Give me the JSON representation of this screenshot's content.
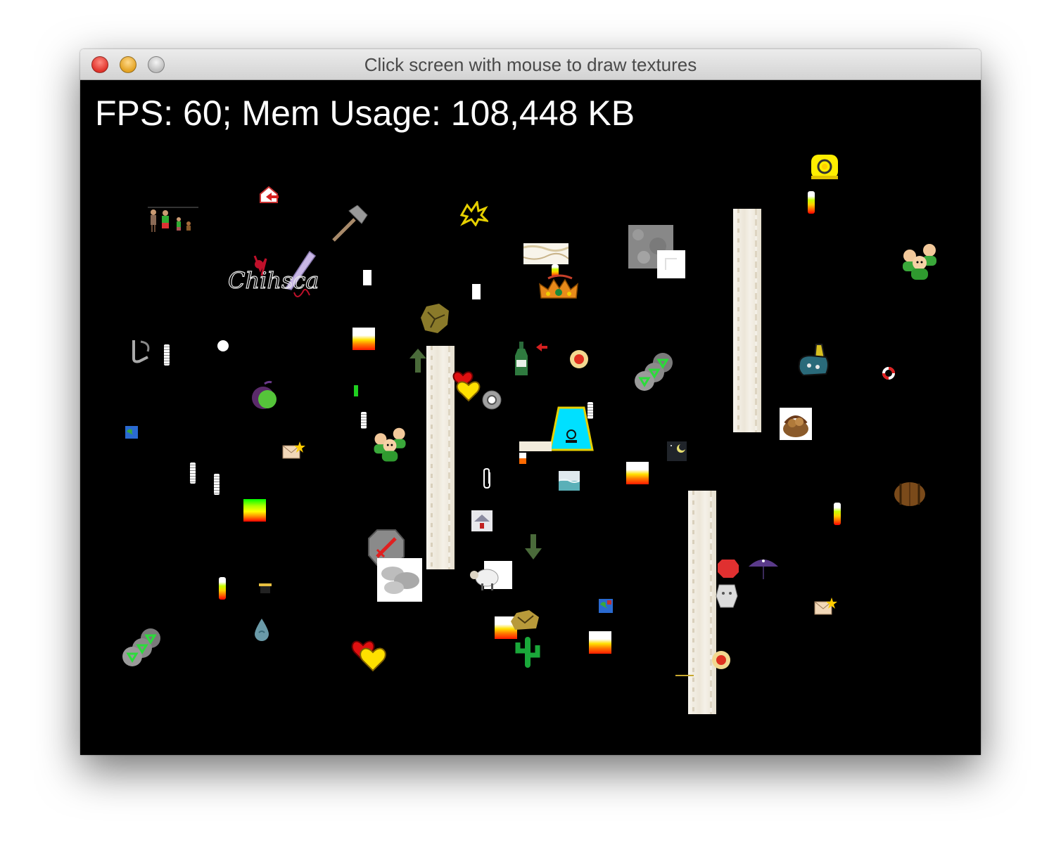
{
  "window": {
    "title": "Click screen with mouse to draw textures"
  },
  "overlay": {
    "stats_text": "FPS: 60; Mem Usage: 108,448 KB"
  },
  "sprites": [
    "hazard-lamp",
    "family-figures",
    "house-arrow",
    "hammer",
    "splat",
    "scroll-banner",
    "gray-stone-block",
    "white-tile",
    "crown",
    "feather-signature",
    "users-group",
    "hook",
    "marble",
    "cracked-rock",
    "heart",
    "bottle",
    "red-gem-button",
    "rock-cluster",
    "purse",
    "lifebuoy",
    "apple",
    "globe",
    "envelope",
    "basket",
    "cyan-trapezoid",
    "paperclip",
    "water-tile",
    "moon-night",
    "barrel",
    "sword-badge",
    "cloud-stone",
    "sheep",
    "down-arrow",
    "umbrella",
    "stone-head",
    "cactus",
    "drop",
    "chest",
    "up-arrow"
  ],
  "colors": {
    "canvas": "#000000",
    "stats_text": "#ffffff",
    "title_text": "#4a4a4a"
  }
}
